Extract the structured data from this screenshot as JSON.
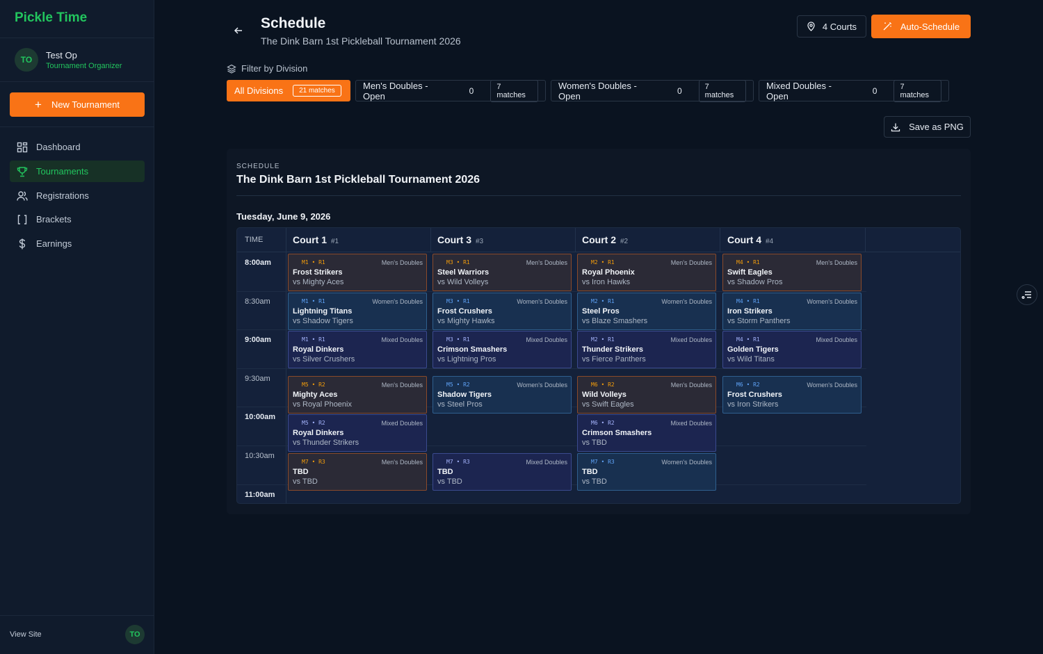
{
  "sidebar": {
    "brand": "Pickle Time",
    "user": {
      "initials": "TO",
      "name": "Test Op",
      "role": "Tournament Organizer"
    },
    "new_button": "New Tournament",
    "nav": [
      {
        "label": "Dashboard",
        "icon": "grid-icon",
        "active": false
      },
      {
        "label": "Tournaments",
        "icon": "trophy-icon",
        "active": true
      },
      {
        "label": "Registrations",
        "icon": "users-icon",
        "active": false
      },
      {
        "label": "Brackets",
        "icon": "brackets-icon",
        "active": false
      },
      {
        "label": "Earnings",
        "icon": "dollar-icon",
        "active": false
      }
    ],
    "view_site": "View Site",
    "footer_initials": "TO"
  },
  "header": {
    "title": "Schedule",
    "subtitle": "The Dink Barn 1st Pickleball Tournament 2026",
    "courts_button": "4 Courts",
    "auto_button": "Auto-Schedule"
  },
  "filter": {
    "label": "Filter by Division",
    "chips": [
      {
        "label": "All Divisions",
        "count": "",
        "matches": "21 matches",
        "active": true
      },
      {
        "label": "Men's Doubles - Open",
        "count": "0",
        "matches": "7 matches",
        "active": false
      },
      {
        "label": "Women's Doubles - Open",
        "count": "0",
        "matches": "7 matches",
        "active": false
      },
      {
        "label": "Mixed Doubles - Open",
        "count": "0",
        "matches": "7 matches",
        "active": false
      }
    ]
  },
  "save_button": "Save as PNG",
  "schedule": {
    "kicker": "SCHEDULE",
    "title": "The Dink Barn 1st Pickleball Tournament 2026",
    "day": "Tuesday, June 9, 2026",
    "time_header": "TIME",
    "courts": [
      {
        "name": "Court 1",
        "num": "#1"
      },
      {
        "name": "Court 3",
        "num": "#3"
      },
      {
        "name": "Court 2",
        "num": "#2"
      },
      {
        "name": "Court 4",
        "num": "#4"
      }
    ],
    "times": [
      {
        "label": "8:00am",
        "hour": true
      },
      {
        "label": "8:30am",
        "hour": false
      },
      {
        "label": "9:00am",
        "hour": true
      },
      {
        "label": "9:30am",
        "hour": false
      },
      {
        "label": "10:00am",
        "hour": true
      },
      {
        "label": "10:30am",
        "hour": false
      },
      {
        "label": "11:00am",
        "hour": true
      }
    ],
    "matches": [
      {
        "court": 0,
        "slot": 0,
        "code": "M1 • R1",
        "division": "Men's Doubles",
        "kind": "men",
        "team": "Frost Strikers",
        "opponent": "vs Mighty Aces"
      },
      {
        "court": 1,
        "slot": 0,
        "code": "M3 • R1",
        "division": "Men's Doubles",
        "kind": "men",
        "team": "Steel Warriors",
        "opponent": "vs Wild Volleys"
      },
      {
        "court": 2,
        "slot": 0,
        "code": "M2 • R1",
        "division": "Men's Doubles",
        "kind": "men",
        "team": "Royal Phoenix",
        "opponent": "vs Iron Hawks"
      },
      {
        "court": 3,
        "slot": 0,
        "code": "M4 • R1",
        "division": "Men's Doubles",
        "kind": "men",
        "team": "Swift Eagles",
        "opponent": "vs Shadow Pros"
      },
      {
        "court": 0,
        "slot": 1,
        "code": "M1 • R1",
        "division": "Women's Doubles",
        "kind": "women",
        "team": "Lightning Titans",
        "opponent": "vs Shadow Tigers"
      },
      {
        "court": 1,
        "slot": 1,
        "code": "M3 • R1",
        "division": "Women's Doubles",
        "kind": "women",
        "team": "Frost Crushers",
        "opponent": "vs Mighty Hawks"
      },
      {
        "court": 2,
        "slot": 1,
        "code": "M2 • R1",
        "division": "Women's Doubles",
        "kind": "women",
        "team": "Steel Pros",
        "opponent": "vs Blaze Smashers"
      },
      {
        "court": 3,
        "slot": 1,
        "code": "M4 • R1",
        "division": "Women's Doubles",
        "kind": "women",
        "team": "Iron Strikers",
        "opponent": "vs Storm Panthers"
      },
      {
        "court": 0,
        "slot": 2,
        "code": "M1 • R1",
        "division": "Mixed Doubles",
        "kind": "mixed",
        "team": "Royal Dinkers",
        "opponent": "vs Silver Crushers"
      },
      {
        "court": 1,
        "slot": 2,
        "code": "M3 • R1",
        "division": "Mixed Doubles",
        "kind": "mixed",
        "team": "Crimson Smashers",
        "opponent": "vs Lightning Pros"
      },
      {
        "court": 2,
        "slot": 2,
        "code": "M2 • R1",
        "division": "Mixed Doubles",
        "kind": "mixed",
        "team": "Thunder Strikers",
        "opponent": "vs Fierce Panthers"
      },
      {
        "court": 3,
        "slot": 2,
        "code": "M4 • R1",
        "division": "Mixed Doubles",
        "kind": "mixed",
        "team": "Golden Tigers",
        "opponent": "vs Wild Titans"
      },
      {
        "court": 0,
        "slot": 3,
        "code": "M5 • R2",
        "division": "Men's Doubles",
        "kind": "men",
        "team": "Mighty Aces",
        "opponent": "vs Royal Phoenix"
      },
      {
        "court": 1,
        "slot": 3,
        "code": "M5 • R2",
        "division": "Women's Doubles",
        "kind": "women",
        "team": "Shadow Tigers",
        "opponent": "vs Steel Pros"
      },
      {
        "court": 2,
        "slot": 3,
        "code": "M6 • R2",
        "division": "Men's Doubles",
        "kind": "men",
        "team": "Wild Volleys",
        "opponent": "vs Swift Eagles"
      },
      {
        "court": 3,
        "slot": 3,
        "code": "M6 • R2",
        "division": "Women's Doubles",
        "kind": "women",
        "team": "Frost Crushers",
        "opponent": "vs Iron Strikers"
      },
      {
        "court": 0,
        "slot": 4,
        "code": "M5 • R2",
        "division": "Mixed Doubles",
        "kind": "mixed",
        "team": "Royal Dinkers",
        "opponent": "vs Thunder Strikers"
      },
      {
        "court": 2,
        "slot": 4,
        "code": "M6 • R2",
        "division": "Mixed Doubles",
        "kind": "mixed",
        "team": "Crimson Smashers",
        "opponent": "vs TBD"
      },
      {
        "court": 0,
        "slot": 5,
        "code": "M7 • R3",
        "division": "Men's Doubles",
        "kind": "men",
        "team": "TBD",
        "opponent": "vs TBD"
      },
      {
        "court": 1,
        "slot": 5,
        "code": "M7 • R3",
        "division": "Mixed Doubles",
        "kind": "mixed",
        "team": "TBD",
        "opponent": "vs TBD"
      },
      {
        "court": 2,
        "slot": 5,
        "code": "M7 • R3",
        "division": "Women's Doubles",
        "kind": "women",
        "team": "TBD",
        "opponent": "vs TBD"
      }
    ]
  },
  "colors": {
    "accent": "#f97316",
    "brand": "#22c55e",
    "men": "#f59e0b",
    "women": "#60a5fa",
    "mixed": "#a5b4fc"
  }
}
